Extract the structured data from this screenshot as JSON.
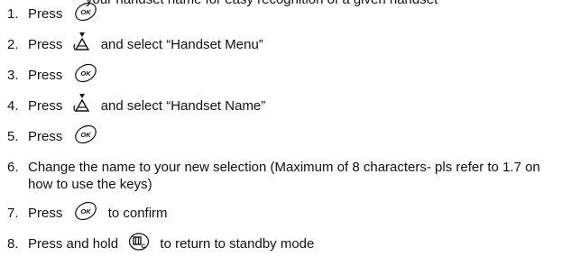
{
  "intro_clipped": "your handset name for easy recognition of a given handset",
  "steps": [
    {
      "num": "1.",
      "before": "Press",
      "icon": "ok-button-icon",
      "after": ""
    },
    {
      "num": "2.",
      "before": "Press",
      "icon": "navigation-down-icon",
      "after": "and select “Handset Menu”"
    },
    {
      "num": "3.",
      "before": "Press",
      "icon": "ok-button-icon",
      "after": ""
    },
    {
      "num": "4.",
      "before": "Press",
      "icon": "navigation-down-icon",
      "after": "and select “Handset Name”"
    },
    {
      "num": "5.",
      "before": "Press",
      "icon": "ok-button-icon",
      "after": ""
    },
    {
      "num": "6.",
      "text": "Change the name to your new selection (Maximum of 8 characters- pls refer to 1.7 on how to use the keys)"
    },
    {
      "num": "7.",
      "before": "Press",
      "icon": "ok-button-icon",
      "after": "to confirm"
    },
    {
      "num": "8.",
      "before": "Press and hold",
      "icon": "clear-button-icon",
      "after": "to return to standby mode"
    }
  ],
  "icons": {
    "ok_label": "OK",
    "clear_label": "C"
  }
}
